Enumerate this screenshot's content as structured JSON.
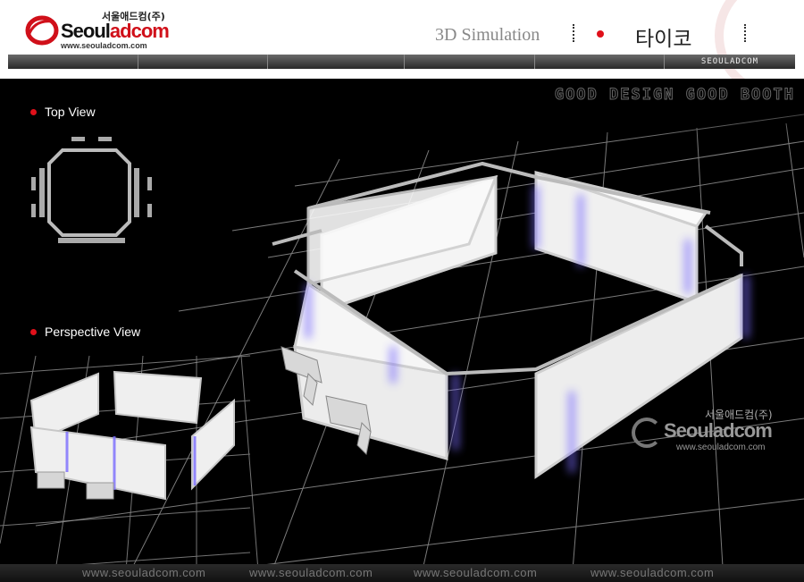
{
  "header": {
    "logo_korean": "서울애드컴(주)",
    "logo_main_prefix": "Seoul",
    "logo_main_suffix": "adcom",
    "logo_url": "www.seouladcom.com",
    "simulation_title": "3D Simulation",
    "product_title": "타이코",
    "nav_brand": "SEOULADCOM"
  },
  "stage": {
    "tagline": "GOOD DESIGN GOOD BOOTH",
    "top_view_label": "Top View",
    "perspective_view_label": "Perspective View"
  },
  "watermark": {
    "korean": "서울애드컴(주)",
    "main": "Seouladcom",
    "url": "www.seouladcom.com"
  },
  "footer": {
    "urls": [
      "www.seouladcom.com",
      "www.seouladcom.com",
      "www.seouladcom.com",
      "www.seouladcom.com"
    ]
  },
  "colors": {
    "accent": "#e0101a",
    "background": "#000000",
    "panel": "#f2f2f2",
    "glow": "#7a6cff"
  },
  "icons": [
    "logo-swirl-icon",
    "red-bullet-icon"
  ]
}
